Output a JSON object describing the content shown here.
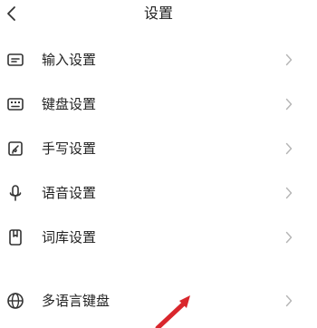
{
  "header": {
    "back_icon": "chevron-left-icon",
    "title": "设置"
  },
  "items": [
    {
      "icon": "input-settings-icon",
      "label": "输入设置"
    },
    {
      "icon": "keyboard-icon",
      "label": "键盘设置"
    },
    {
      "icon": "handwriting-icon",
      "label": "手写设置"
    },
    {
      "icon": "microphone-icon",
      "label": "语音设置"
    },
    {
      "icon": "lexicon-icon",
      "label": "词库设置"
    },
    {
      "icon": "globe-icon",
      "label": "多语言键盘"
    }
  ],
  "colors": {
    "text": "#222222",
    "icon": "#333333",
    "chevron": "#b5b5b5",
    "annotation_arrow": "#d9262c"
  }
}
